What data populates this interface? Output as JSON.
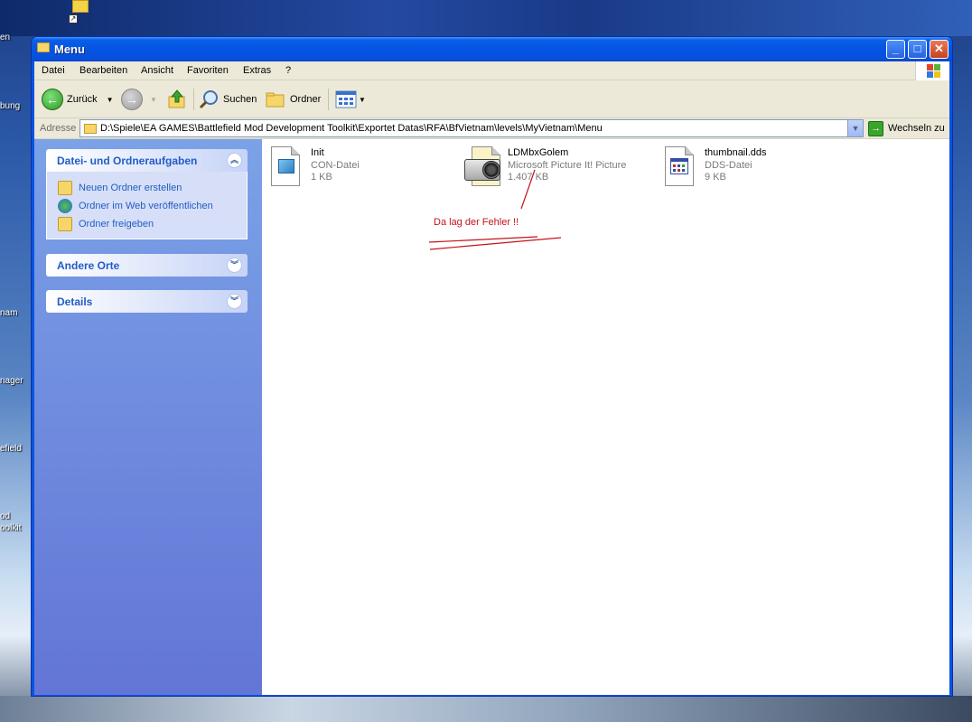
{
  "desktop": {
    "labels": [
      "en",
      "bung",
      "nam",
      "nager",
      "efield",
      "od",
      "oolkit"
    ]
  },
  "window": {
    "title": "Menu",
    "controls": {
      "minimize": "_",
      "maximize": "□",
      "close": "✕"
    }
  },
  "menubar": {
    "items": [
      "Datei",
      "Bearbeiten",
      "Ansicht",
      "Favoriten",
      "Extras",
      "?"
    ]
  },
  "toolbar": {
    "back_label": "Zurück",
    "search_label": "Suchen",
    "folders_label": "Ordner"
  },
  "address": {
    "label": "Adresse",
    "path": "D:\\Spiele\\EA GAMES\\Battlefield Mod Development Toolkit\\Exportet Datas\\RFA\\BfVietnam\\levels\\MyVietnam\\Menu",
    "go_label": "Wechseln zu"
  },
  "taskpane": {
    "tasks": {
      "title": "Datei- und Ordneraufgaben",
      "items": [
        "Neuen Ordner erstellen",
        "Ordner im Web veröffentlichen",
        "Ordner freigeben"
      ]
    },
    "other_places": {
      "title": "Andere Orte"
    },
    "details": {
      "title": "Details"
    }
  },
  "files": [
    {
      "name": "Init",
      "type": "CON-Datei",
      "size": "1 KB",
      "icon": "con-file-icon"
    },
    {
      "name": "LDMbxGolem",
      "type": "Microsoft Picture It! Picture",
      "size": "1.407 KB",
      "icon": "camera-icon"
    },
    {
      "name": "thumbnail.dds",
      "type": "DDS-Datei",
      "size": "9 KB",
      "icon": "dds-file-icon"
    }
  ],
  "annotation": {
    "text": "Da lag der Fehler !!",
    "color": "#c4131a"
  }
}
